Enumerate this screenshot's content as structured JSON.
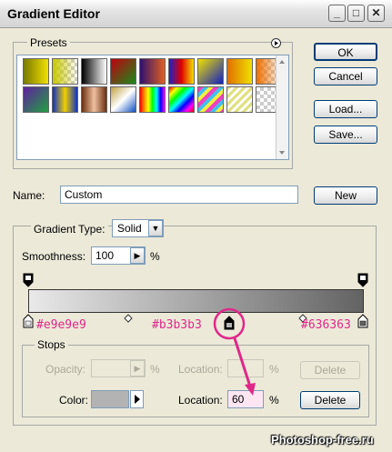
{
  "window": {
    "title": "Gradient Editor"
  },
  "titlebar_buttons": {
    "minimize": "_",
    "maximize": "□",
    "close": "✕"
  },
  "buttons": {
    "ok": "OK",
    "cancel": "Cancel",
    "load": "Load...",
    "save": "Save...",
    "new": "New",
    "delete_disabled": "Delete",
    "delete": "Delete"
  },
  "presets": {
    "label": "Presets"
  },
  "name": {
    "label": "Name:",
    "value": "Custom"
  },
  "gradient_type": {
    "label": "Gradient Type:",
    "value": "Solid"
  },
  "smoothness": {
    "label": "Smoothness:",
    "value": "100",
    "unit": "%"
  },
  "gradient": {
    "start_color": "#e9e9e9",
    "end_color": "#636363"
  },
  "stop_labels": {
    "left": "#e9e9e9",
    "middle": "#b3b3b3",
    "right": "#636363"
  },
  "stops": {
    "label": "Stops",
    "opacity_label": "Opacity:",
    "opacity_unit": "%",
    "location_label_disabled": "Location:",
    "location_unit_disabled": "%",
    "color_label": "Color:",
    "color_value": "#b3b3b3",
    "location_label": "Location:",
    "location_value": "60",
    "location_unit": "%"
  },
  "watermark": "Photoshop-free.ru",
  "accent_color": "#e0288a"
}
